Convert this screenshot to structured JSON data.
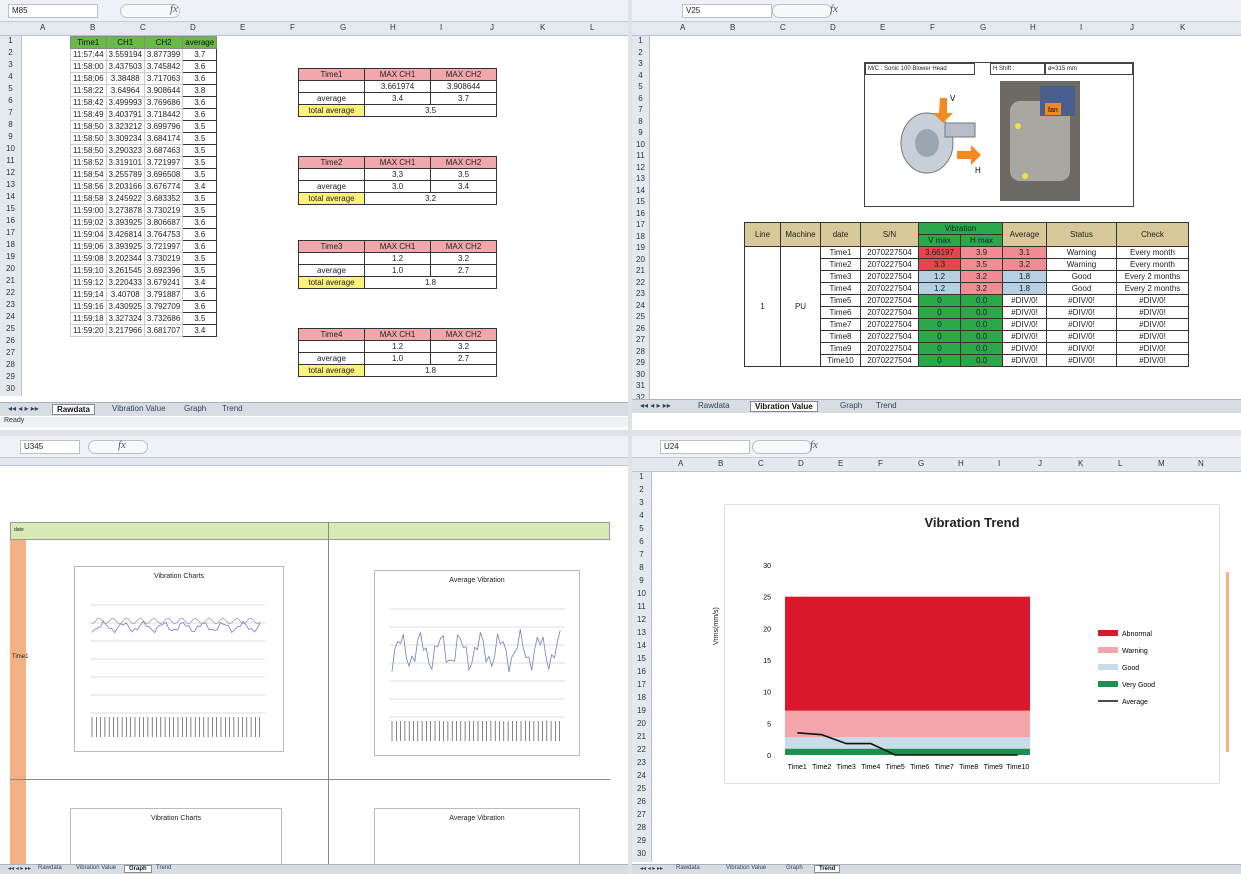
{
  "q1": {
    "namebox": "M85",
    "cols": [
      "A",
      "B",
      "C",
      "D",
      "E",
      "F",
      "G",
      "H",
      "I",
      "J",
      "K",
      "L"
    ],
    "headers": [
      "Time1",
      "CH1",
      "CH2",
      "average"
    ],
    "rows": [
      [
        "11:57:44",
        "3.559194",
        "3.877399",
        "3.7"
      ],
      [
        "11:58:00",
        "3.437503",
        "3.745842",
        "3.6"
      ],
      [
        "11:58:06",
        "3.38488",
        "3.717063",
        "3.6"
      ],
      [
        "11:58:22",
        "3.64964",
        "3.908644",
        "3.8"
      ],
      [
        "11:58:42",
        "3.499993",
        "3.769686",
        "3.6"
      ],
      [
        "11:58:49",
        "3.403791",
        "3.718442",
        "3.6"
      ],
      [
        "11:58:50",
        "3.323212",
        "3.699796",
        "3.5"
      ],
      [
        "11:58:50",
        "3.309234",
        "3.684174",
        "3.5"
      ],
      [
        "11:58:50",
        "3.290323",
        "3.687463",
        "3.5"
      ],
      [
        "11:58:52",
        "3.319101",
        "3.721997",
        "3.5"
      ],
      [
        "11:58:54",
        "3.255789",
        "3.696508",
        "3.5"
      ],
      [
        "11:58:56",
        "3.203166",
        "3.676774",
        "3.4"
      ],
      [
        "11:58:58",
        "3.245922",
        "3.683352",
        "3.5"
      ],
      [
        "11:59:00",
        "3.273878",
        "3.730219",
        "3.5"
      ],
      [
        "11:59:02",
        "3.393925",
        "3.806687",
        "3.6"
      ],
      [
        "11:59:04",
        "3.426814",
        "3.764753",
        "3.6"
      ],
      [
        "11:59:06",
        "3.393925",
        "3.721997",
        "3.6"
      ],
      [
        "11:59:08",
        "3.202344",
        "3.730219",
        "3.5"
      ],
      [
        "11:59:10",
        "3.261545",
        "3.692396",
        "3.5"
      ],
      [
        "11:59:12",
        "3.220433",
        "3.679241",
        "3.4"
      ],
      [
        "11:59:14",
        "3.40708",
        "3.791887",
        "3.6"
      ],
      [
        "11:59:16",
        "3.430925",
        "3.792709",
        "3.6"
      ],
      [
        "11:59:18",
        "3.327324",
        "3.732686",
        "3.5"
      ],
      [
        "11:59:20",
        "3.217966",
        "3.681707",
        "3.4"
      ]
    ],
    "summaries": [
      {
        "label": "Time1",
        "maxch1": "3.661974",
        "maxch2": "3.908644",
        "avg1": "3.4",
        "avg2": "3.7",
        "total": "3.5"
      },
      {
        "label": "Time2",
        "maxch1": "3.3",
        "maxch2": "3.5",
        "avg1": "3.0",
        "avg2": "3.4",
        "total": "3.2"
      },
      {
        "label": "Time3",
        "maxch1": "1.2",
        "maxch2": "3.2",
        "avg1": "1.0",
        "avg2": "2.7",
        "total": "1.8"
      },
      {
        "label": "Time4",
        "maxch1": "1.2",
        "maxch2": "3.2",
        "avg1": "1.0",
        "avg2": "2.7",
        "total": "1.8"
      }
    ],
    "labels": {
      "max_ch1": "MAX CH1",
      "max_ch2": "MAX CH2",
      "average": "average",
      "total_average": "total average"
    },
    "tabs": [
      "Rawdata",
      "Vibration Value",
      "Graph",
      "Trend"
    ],
    "status": "Ready"
  },
  "q2": {
    "namebox": "V25",
    "cols": [
      "A",
      "B",
      "C",
      "D",
      "E",
      "F",
      "G",
      "H",
      "I",
      "J",
      "K"
    ],
    "info_machine": "M/C : Sonic 100 Blower Head",
    "info_shift": "H Shift :",
    "info_size": "ø=315 mm",
    "label_v": "V",
    "label_h": "H",
    "label_fan": "fan",
    "headers": {
      "line": "Line",
      "machine": "Machine",
      "date": "date",
      "sn": "S/N",
      "vibration": "Vibration",
      "vmax": "V max",
      "hmax": "H max",
      "average": "Average",
      "status": "Status",
      "check": "Check"
    },
    "line": "1",
    "machine": "PU",
    "rows": [
      {
        "date": "Time1",
        "sn": "2070227504",
        "v": "3.66197",
        "h": "3.9",
        "avg": "3.1",
        "status": "Warning",
        "check": "Every month"
      },
      {
        "date": "Time2",
        "sn": "2070227504",
        "v": "3.3",
        "h": "3.5",
        "avg": "3.2",
        "status": "Warning",
        "check": "Every month"
      },
      {
        "date": "Time3",
        "sn": "2070227504",
        "v": "1.2",
        "h": "3.2",
        "avg": "1.8",
        "status": "Good",
        "check": "Every 2 months"
      },
      {
        "date": "Time4",
        "sn": "2070227504",
        "v": "1.2",
        "h": "3.2",
        "avg": "1.8",
        "status": "Good",
        "check": "Every 2 months"
      },
      {
        "date": "Time5",
        "sn": "2070227504",
        "v": "0",
        "h": "0.0",
        "avg": "#DIV/0!",
        "status": "#DIV/0!",
        "check": "#DIV/0!"
      },
      {
        "date": "Time6",
        "sn": "2070227504",
        "v": "0",
        "h": "0.0",
        "avg": "#DIV/0!",
        "status": "#DIV/0!",
        "check": "#DIV/0!"
      },
      {
        "date": "Time7",
        "sn": "2070227504",
        "v": "0",
        "h": "0.0",
        "avg": "#DIV/0!",
        "status": "#DIV/0!",
        "check": "#DIV/0!"
      },
      {
        "date": "Time8",
        "sn": "2070227504",
        "v": "0",
        "h": "0.0",
        "avg": "#DIV/0!",
        "status": "#DIV/0!",
        "check": "#DIV/0!"
      },
      {
        "date": "Time9",
        "sn": "2070227504",
        "v": "0",
        "h": "0.0",
        "avg": "#DIV/0!",
        "status": "#DIV/0!",
        "check": "#DIV/0!"
      },
      {
        "date": "Time10",
        "sn": "2070227504",
        "v": "0",
        "h": "0.0",
        "avg": "#DIV/0!",
        "status": "#DIV/0!",
        "check": "#DIV/0!"
      }
    ],
    "tabs": [
      "Rawdata",
      "Vibration Value",
      "Graph",
      "Trend"
    ]
  },
  "q3": {
    "namebox": "U345",
    "side_top": "date",
    "side_mid": "Time1",
    "chart1_title": "Vibration Charts",
    "chart2_title": "Average Vibration",
    "chart3_title": "Vibration Charts",
    "chart4_title": "Average Vibration",
    "tabs": [
      "Rawdata",
      "Vibration Value",
      "Graph",
      "Trend"
    ]
  },
  "q4": {
    "namebox": "U24",
    "cols": [
      "A",
      "B",
      "C",
      "D",
      "E",
      "F",
      "G",
      "H",
      "I",
      "J",
      "K",
      "L",
      "M",
      "N"
    ],
    "tabs": [
      "Rawdata",
      "Vibration Value",
      "Graph",
      "Trend"
    ]
  },
  "chart_data": {
    "type": "area",
    "title": "Vibration Trend",
    "ylabel": "Vrms(mm/s)",
    "xlabel": "",
    "categories": [
      "Time1",
      "Time2",
      "Time3",
      "Time4",
      "Time5",
      "Time6",
      "Time7",
      "Time8",
      "Time9",
      "Time10"
    ],
    "ylim": [
      0,
      30
    ],
    "yticks": [
      0,
      5,
      10,
      15,
      20,
      25,
      30
    ],
    "bands": [
      {
        "name": "Very Good",
        "from": 0,
        "to": 1,
        "color": "#1e8f4e"
      },
      {
        "name": "Good",
        "from": 1,
        "to": 2.8,
        "color": "#c9dcea"
      },
      {
        "name": "Warning",
        "from": 2.8,
        "to": 7,
        "color": "#f2a5ab"
      },
      {
        "name": "Abnormal",
        "from": 7,
        "to": 25,
        "color": "#d9182b"
      }
    ],
    "series": [
      {
        "name": "Average",
        "values": [
          3.5,
          3.2,
          1.8,
          1.8,
          0,
          0,
          0,
          0,
          0,
          0
        ],
        "color": "#111111"
      }
    ],
    "legend": "right"
  }
}
